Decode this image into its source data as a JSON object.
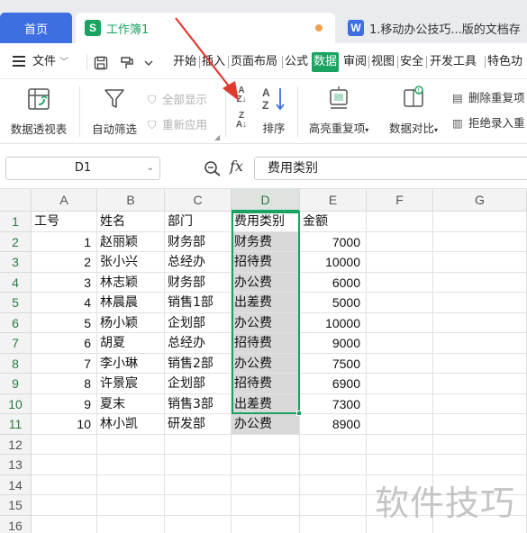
{
  "tabs": {
    "home": "首页",
    "workbook_icon": "S",
    "workbook": "工作簿1",
    "other_icon": "W",
    "other": "1.移动办公技巧...版的文档存"
  },
  "menu": {
    "file": "文件",
    "items": [
      "开始",
      "插入",
      "页面布局",
      "公式",
      "数据",
      "审阅",
      "视图",
      "安全",
      "开发工具",
      "特色功"
    ],
    "active": "数据"
  },
  "ribbon": {
    "pivot": "数据透视表",
    "autofilter": "自动筛选",
    "show_all": "全部显示",
    "reapply": "重新应用",
    "sort": "排序",
    "highlight_dup": "高亮重复项",
    "compare": "数据对比",
    "remove_dup": "删除重复项",
    "reject_dup": "拒绝录入重"
  },
  "formula": {
    "cell_ref": "D1",
    "fx": "fx",
    "content": "费用类别"
  },
  "grid": {
    "columns": [
      "A",
      "B",
      "C",
      "D",
      "E",
      "F",
      "G"
    ],
    "rows": [
      "1",
      "2",
      "3",
      "4",
      "5",
      "6",
      "7",
      "8",
      "9",
      "10",
      "11",
      "12",
      "13",
      "14",
      "15",
      "16"
    ],
    "header": [
      "工号",
      "姓名",
      "部门",
      "费用类别",
      "金额"
    ],
    "data": [
      [
        "1",
        "赵丽颖",
        "财务部",
        "财务费",
        "7000"
      ],
      [
        "2",
        "张小兴",
        "总经办",
        "招待费",
        "10000"
      ],
      [
        "3",
        "林志颖",
        "财务部",
        "办公费",
        "6000"
      ],
      [
        "4",
        "林晨晨",
        "销售1部",
        "出差费",
        "5000"
      ],
      [
        "5",
        "杨小颖",
        "企划部",
        "办公费",
        "10000"
      ],
      [
        "6",
        "胡夏",
        "总经办",
        "招待费",
        "9000"
      ],
      [
        "7",
        "李小琳",
        "销售2部",
        "办公费",
        "7500"
      ],
      [
        "8",
        "许景宸",
        "企划部",
        "招待费",
        "6900"
      ],
      [
        "9",
        "夏末",
        "销售3部",
        "出差费",
        "7300"
      ],
      [
        "10",
        "林小凯",
        "研发部",
        "办公费",
        "8900"
      ]
    ]
  },
  "watermark": "软件技巧",
  "colors": {
    "accent": "#1aa260",
    "home_tab": "#3d6fe0",
    "arrow": "#e03a2f"
  }
}
